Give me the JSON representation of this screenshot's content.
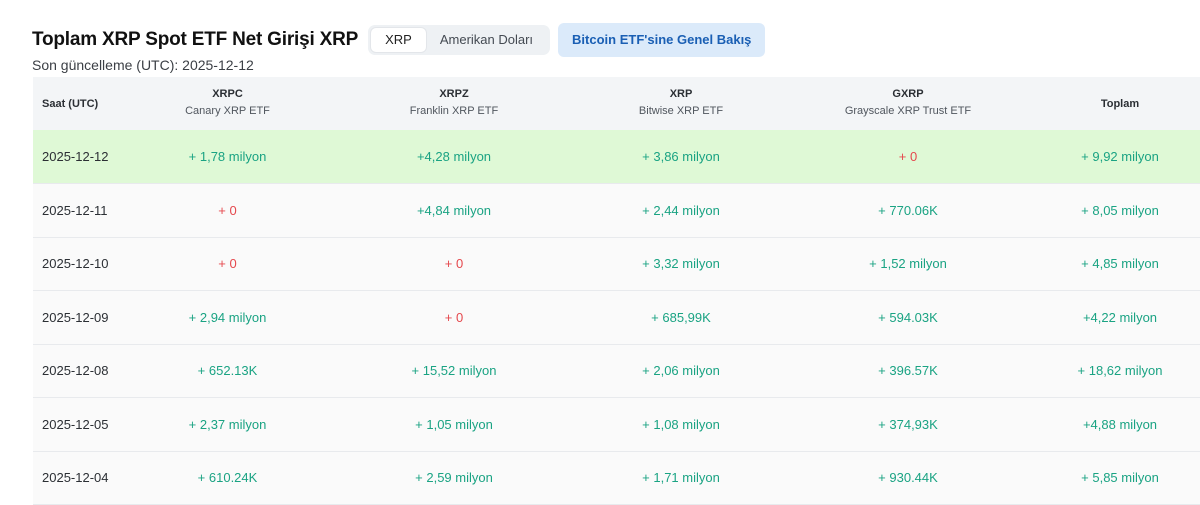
{
  "header": {
    "title": "Toplam XRP Spot ETF Net Girişi XRP",
    "toggle": [
      {
        "label": "XRP",
        "active": true
      },
      {
        "label": "Amerikan Doları",
        "active": false
      }
    ],
    "overview_button": "Bitcoin ETF'sine Genel Bakış",
    "last_updated": "Son güncelleme (UTC): 2025-12-12"
  },
  "colors": {
    "positive": "#1aa383",
    "zero": "#e5484d",
    "highlight_row": "#dff9d6",
    "accent_button_bg": "#dbeafa",
    "accent_button_text": "#1a5fb4"
  },
  "table": {
    "columns": [
      {
        "symbol": "Saat (UTC)",
        "name": ""
      },
      {
        "symbol": "XRPC",
        "name": "Canary XRP ETF"
      },
      {
        "symbol": "XRPZ",
        "name": "Franklin XRP ETF"
      },
      {
        "symbol": "XRP",
        "name": "Bitwise XRP ETF"
      },
      {
        "symbol": "GXRP",
        "name": "Grayscale XRP Trust ETF"
      },
      {
        "symbol": "Toplam",
        "name": ""
      }
    ],
    "rows": [
      {
        "date": "2025-12-12",
        "highlight": true,
        "cells": [
          "+ 1,78 milyon",
          "+4,28 milyon",
          "+ 3,86 milyon",
          "+ 0",
          "+ 9,92 milyon"
        ]
      },
      {
        "date": "2025-12-11",
        "highlight": false,
        "cells": [
          "+ 0",
          "+4,84 milyon",
          "+ 2,44 milyon",
          "+ 770.06K",
          "+ 8,05 milyon"
        ]
      },
      {
        "date": "2025-12-10",
        "highlight": false,
        "cells": [
          "+ 0",
          "+ 0",
          "+ 3,32 milyon",
          "+ 1,52 milyon",
          "+ 4,85 milyon"
        ]
      },
      {
        "date": "2025-12-09",
        "highlight": false,
        "cells": [
          "+ 2,94 milyon",
          "+ 0",
          "+ 685,99K",
          "+ 594.03K",
          "+4,22 milyon"
        ]
      },
      {
        "date": "2025-12-08",
        "highlight": false,
        "cells": [
          "+ 652.13K",
          "+ 15,52 milyon",
          "+ 2,06 milyon",
          "+ 396.57K",
          "+ 18,62 milyon"
        ]
      },
      {
        "date": "2025-12-05",
        "highlight": false,
        "cells": [
          "+ 2,37 milyon",
          "+ 1,05 milyon",
          "+ 1,08 milyon",
          "+ 374,93K",
          "+4,88 milyon"
        ]
      },
      {
        "date": "2025-12-04",
        "highlight": false,
        "cells": [
          "+ 610.24K",
          "+ 2,59 milyon",
          "+ 1,71 milyon",
          "+ 930.44K",
          "+ 5,85 milyon"
        ]
      }
    ]
  }
}
